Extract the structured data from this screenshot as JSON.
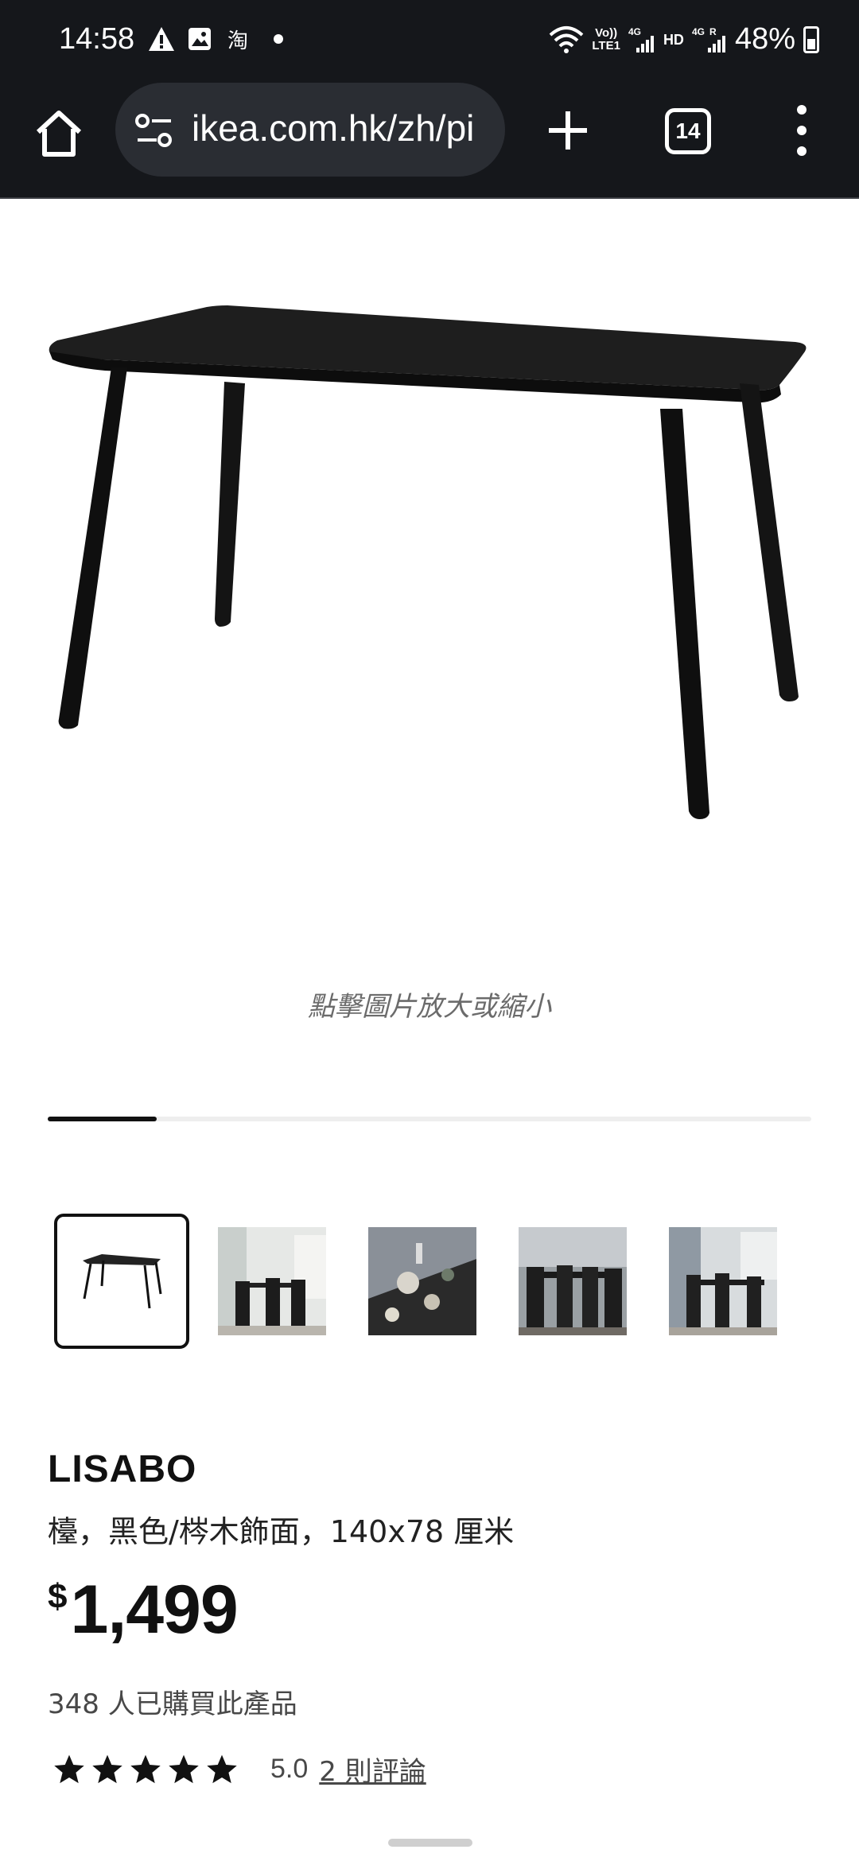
{
  "status_bar": {
    "time": "14:58",
    "battery": "48%",
    "left_icons": [
      "warning-icon",
      "image-icon",
      "taobao-icon"
    ],
    "taobao_glyph": "淘",
    "net_tags": {
      "volte": "Vo))\nLTE1",
      "g1": "4G",
      "hd": "HD",
      "g2": "4G",
      "r": "R"
    }
  },
  "browser": {
    "url": "ikea.com.hk/zh/pi",
    "tab_count": "14"
  },
  "product": {
    "zoom_hint": "點擊圖片放大或縮小",
    "gallery_progress": 0.143,
    "thumbnails": [
      "table-cutout",
      "dining-room-1",
      "table-top-closeup",
      "dining-room-2",
      "dining-room-3"
    ],
    "name": "LISABO",
    "description": "檯，黑色/梣木飾面，140x78 厘米",
    "price_currency": "$",
    "price_value": "1,499",
    "purchase_count": "348 人已購買此產品",
    "rating_value": "5.0",
    "rating_stars": 5,
    "review_link": "2 則評論"
  }
}
